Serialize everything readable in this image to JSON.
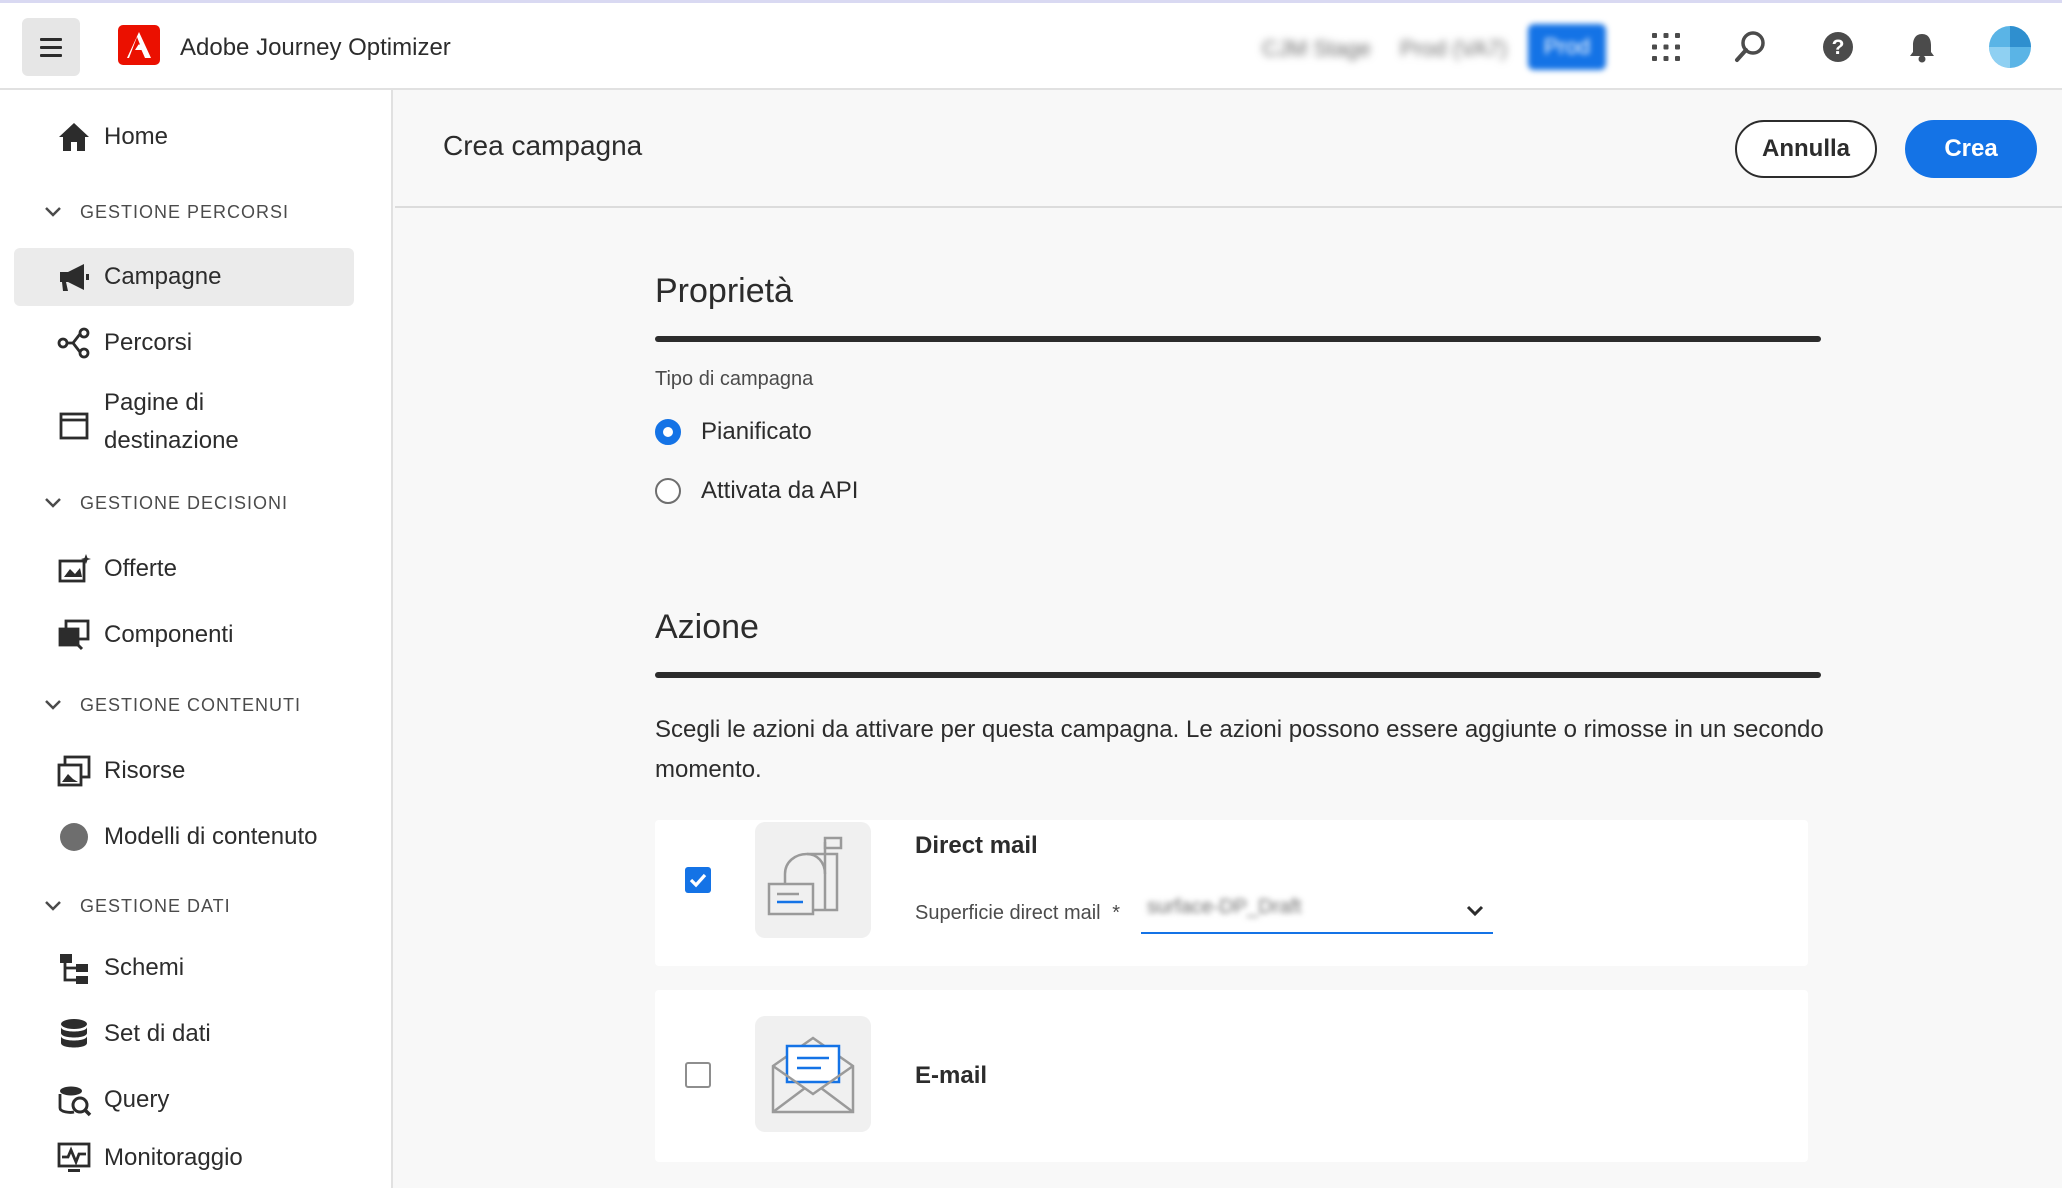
{
  "app": {
    "title": "Adobe Journey Optimizer"
  },
  "header": {
    "env_stage": "CJM Stage",
    "env_prod_uat": "Prod (VA7)",
    "env_prod": "Prod"
  },
  "sidebar": {
    "home": "Home",
    "section_journeys": "GESTIONE PERCORSI",
    "campaigns": "Campagne",
    "journeys": "Percorsi",
    "landing_pages": "Pagine di destinazione",
    "section_decisions": "GESTIONE DECISIONI",
    "offers": "Offerte",
    "components": "Componenti",
    "section_content": "GESTIONE CONTENUTI",
    "assets": "Risorse",
    "content_templates": "Modelli di contenuto",
    "section_data": "GESTIONE DATI",
    "schemas": "Schemi",
    "datasets": "Set di dati",
    "queries": "Query",
    "monitoring": "Monitoraggio"
  },
  "page": {
    "title": "Crea campagna",
    "cancel_label": "Annulla",
    "create_label": "Crea"
  },
  "properties": {
    "heading": "Proprietà",
    "campaign_type_label": "Tipo di campagna",
    "option_scheduled": "Pianificato",
    "option_api": "Attivata da API",
    "selected": "Pianificato"
  },
  "actions": {
    "heading": "Azione",
    "description": "Scegli le azioni da attivare per questa campagna. Le azioni possono essere aggiunte o rimosse in un secondo momento.",
    "direct_mail": {
      "title": "Direct mail",
      "checked": true,
      "surface_label": "Superficie direct mail",
      "required_mark": "*",
      "surface_value": "surface-DP_Draft"
    },
    "email": {
      "title": "E-mail",
      "checked": false
    }
  },
  "colors": {
    "accent": "#1473e6",
    "adobe_red": "#eb1000",
    "text": "#2c2c2c"
  }
}
